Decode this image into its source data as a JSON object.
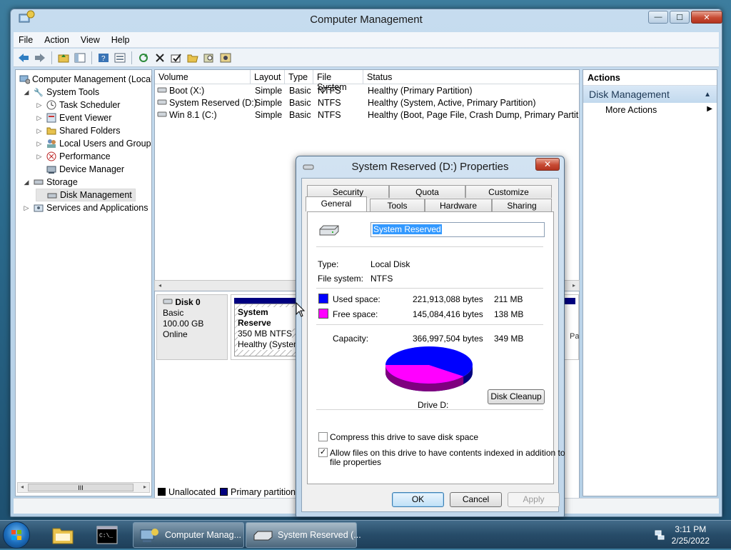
{
  "window": {
    "title": "Computer Management",
    "minimize_glyph": "—",
    "maximize_glyph": "☐",
    "close_glyph": "✕"
  },
  "menu": [
    "File",
    "Action",
    "View",
    "Help"
  ],
  "toolbar_icons": [
    "back-arrow-icon",
    "forward-arrow-icon",
    "up-folder-icon",
    "show-hide-tree-icon",
    "help-icon",
    "properties-icon",
    "refresh-icon",
    "delete-icon",
    "check-icon",
    "open-folder-icon",
    "search-icon",
    "settings-icon"
  ],
  "tree": {
    "root": "Computer Management (Local",
    "items": [
      {
        "label": "System Tools",
        "exp": "◢"
      },
      {
        "label": "Task Scheduler",
        "exp": "▷"
      },
      {
        "label": "Event Viewer",
        "exp": "▷"
      },
      {
        "label": "Shared Folders",
        "exp": "▷"
      },
      {
        "label": "Local Users and Groups",
        "exp": "▷"
      },
      {
        "label": "Performance",
        "exp": "▷"
      },
      {
        "label": "Device Manager",
        "exp": ""
      },
      {
        "label": "Storage",
        "exp": "◢"
      },
      {
        "label": "Disk Management",
        "exp": ""
      },
      {
        "label": "Services and Applications",
        "exp": "▷"
      }
    ],
    "scroll_thumb": "III"
  },
  "volumes": {
    "headers": [
      "Volume",
      "Layout",
      "Type",
      "File System",
      "Status"
    ],
    "rows": [
      [
        "Boot (X:)",
        "Simple",
        "Basic",
        "NTFS",
        "Healthy (Primary Partition)"
      ],
      [
        "System Reserved (D:)",
        "Simple",
        "Basic",
        "NTFS",
        "Healthy (System, Active, Primary Partition)"
      ],
      [
        "Win 8.1 (C:)",
        "Simple",
        "Basic",
        "NTFS",
        "Healthy (Boot, Page File, Crash Dump, Primary Partition)"
      ]
    ]
  },
  "disk": {
    "name": "Disk 0",
    "type": "Basic",
    "size": "100.00 GB",
    "state": "Online",
    "partition_name": "System Reserve",
    "partition_size": "350 MB NTFS",
    "partition_status": "Healthy (System",
    "right_fragment": "Pa"
  },
  "legend": {
    "unallocated": "Unallocated",
    "primary": "Primary partition",
    "unallocated_color": "#000000",
    "primary_color": "#00007f"
  },
  "actions": {
    "header": "Actions",
    "section": "Disk Management",
    "more": "More Actions"
  },
  "dialog": {
    "title": "System Reserved (D:) Properties",
    "tabs_top": [
      "Security",
      "Quota",
      "Customize"
    ],
    "tabs_bottom": [
      "General",
      "Tools",
      "Hardware",
      "Sharing"
    ],
    "name_value": "System Reserved",
    "type_label": "Type:",
    "type_value": "Local Disk",
    "fs_label": "File system:",
    "fs_value": "NTFS",
    "used_label": "Used space:",
    "used_bytes": "221,913,088 bytes",
    "used_mb": "211 MB",
    "free_label": "Free space:",
    "free_bytes": "145,084,416 bytes",
    "free_mb": "138 MB",
    "capacity_label": "Capacity:",
    "capacity_bytes": "366,997,504 bytes",
    "capacity_mb": "349 MB",
    "used_color": "#0000ff",
    "free_color": "#ff00ff",
    "used_fraction": 0.605,
    "drive_label": "Drive D:",
    "cleanup_button": "Disk Cleanup",
    "compress_label": "Compress this drive to save disk space",
    "compress_checked": false,
    "index_label_1": "Allow files on this drive to have contents indexed in addition to",
    "index_label_2": "file properties",
    "index_checked": true,
    "ok": "OK",
    "cancel": "Cancel",
    "apply": "Apply"
  },
  "taskbar": {
    "tasks": [
      "Computer Manag...",
      "System Reserved (..."
    ],
    "time": "3:11 PM",
    "date": "2/25/2022"
  }
}
